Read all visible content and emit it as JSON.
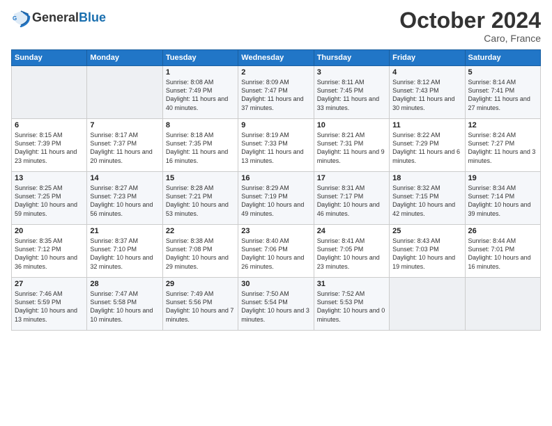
{
  "header": {
    "logo_line1": "General",
    "logo_line2": "Blue",
    "month": "October 2024",
    "location": "Caro, France"
  },
  "weekdays": [
    "Sunday",
    "Monday",
    "Tuesday",
    "Wednesday",
    "Thursday",
    "Friday",
    "Saturday"
  ],
  "weeks": [
    [
      {
        "day": "",
        "info": ""
      },
      {
        "day": "",
        "info": ""
      },
      {
        "day": "1",
        "info": "Sunrise: 8:08 AM\nSunset: 7:49 PM\nDaylight: 11 hours and 40 minutes."
      },
      {
        "day": "2",
        "info": "Sunrise: 8:09 AM\nSunset: 7:47 PM\nDaylight: 11 hours and 37 minutes."
      },
      {
        "day": "3",
        "info": "Sunrise: 8:11 AM\nSunset: 7:45 PM\nDaylight: 11 hours and 33 minutes."
      },
      {
        "day": "4",
        "info": "Sunrise: 8:12 AM\nSunset: 7:43 PM\nDaylight: 11 hours and 30 minutes."
      },
      {
        "day": "5",
        "info": "Sunrise: 8:14 AM\nSunset: 7:41 PM\nDaylight: 11 hours and 27 minutes."
      }
    ],
    [
      {
        "day": "6",
        "info": "Sunrise: 8:15 AM\nSunset: 7:39 PM\nDaylight: 11 hours and 23 minutes."
      },
      {
        "day": "7",
        "info": "Sunrise: 8:17 AM\nSunset: 7:37 PM\nDaylight: 11 hours and 20 minutes."
      },
      {
        "day": "8",
        "info": "Sunrise: 8:18 AM\nSunset: 7:35 PM\nDaylight: 11 hours and 16 minutes."
      },
      {
        "day": "9",
        "info": "Sunrise: 8:19 AM\nSunset: 7:33 PM\nDaylight: 11 hours and 13 minutes."
      },
      {
        "day": "10",
        "info": "Sunrise: 8:21 AM\nSunset: 7:31 PM\nDaylight: 11 hours and 9 minutes."
      },
      {
        "day": "11",
        "info": "Sunrise: 8:22 AM\nSunset: 7:29 PM\nDaylight: 11 hours and 6 minutes."
      },
      {
        "day": "12",
        "info": "Sunrise: 8:24 AM\nSunset: 7:27 PM\nDaylight: 11 hours and 3 minutes."
      }
    ],
    [
      {
        "day": "13",
        "info": "Sunrise: 8:25 AM\nSunset: 7:25 PM\nDaylight: 10 hours and 59 minutes."
      },
      {
        "day": "14",
        "info": "Sunrise: 8:27 AM\nSunset: 7:23 PM\nDaylight: 10 hours and 56 minutes."
      },
      {
        "day": "15",
        "info": "Sunrise: 8:28 AM\nSunset: 7:21 PM\nDaylight: 10 hours and 53 minutes."
      },
      {
        "day": "16",
        "info": "Sunrise: 8:29 AM\nSunset: 7:19 PM\nDaylight: 10 hours and 49 minutes."
      },
      {
        "day": "17",
        "info": "Sunrise: 8:31 AM\nSunset: 7:17 PM\nDaylight: 10 hours and 46 minutes."
      },
      {
        "day": "18",
        "info": "Sunrise: 8:32 AM\nSunset: 7:15 PM\nDaylight: 10 hours and 42 minutes."
      },
      {
        "day": "19",
        "info": "Sunrise: 8:34 AM\nSunset: 7:14 PM\nDaylight: 10 hours and 39 minutes."
      }
    ],
    [
      {
        "day": "20",
        "info": "Sunrise: 8:35 AM\nSunset: 7:12 PM\nDaylight: 10 hours and 36 minutes."
      },
      {
        "day": "21",
        "info": "Sunrise: 8:37 AM\nSunset: 7:10 PM\nDaylight: 10 hours and 32 minutes."
      },
      {
        "day": "22",
        "info": "Sunrise: 8:38 AM\nSunset: 7:08 PM\nDaylight: 10 hours and 29 minutes."
      },
      {
        "day": "23",
        "info": "Sunrise: 8:40 AM\nSunset: 7:06 PM\nDaylight: 10 hours and 26 minutes."
      },
      {
        "day": "24",
        "info": "Sunrise: 8:41 AM\nSunset: 7:05 PM\nDaylight: 10 hours and 23 minutes."
      },
      {
        "day": "25",
        "info": "Sunrise: 8:43 AM\nSunset: 7:03 PM\nDaylight: 10 hours and 19 minutes."
      },
      {
        "day": "26",
        "info": "Sunrise: 8:44 AM\nSunset: 7:01 PM\nDaylight: 10 hours and 16 minutes."
      }
    ],
    [
      {
        "day": "27",
        "info": "Sunrise: 7:46 AM\nSunset: 5:59 PM\nDaylight: 10 hours and 13 minutes."
      },
      {
        "day": "28",
        "info": "Sunrise: 7:47 AM\nSunset: 5:58 PM\nDaylight: 10 hours and 10 minutes."
      },
      {
        "day": "29",
        "info": "Sunrise: 7:49 AM\nSunset: 5:56 PM\nDaylight: 10 hours and 7 minutes."
      },
      {
        "day": "30",
        "info": "Sunrise: 7:50 AM\nSunset: 5:54 PM\nDaylight: 10 hours and 3 minutes."
      },
      {
        "day": "31",
        "info": "Sunrise: 7:52 AM\nSunset: 5:53 PM\nDaylight: 10 hours and 0 minutes."
      },
      {
        "day": "",
        "info": ""
      },
      {
        "day": "",
        "info": ""
      }
    ]
  ]
}
